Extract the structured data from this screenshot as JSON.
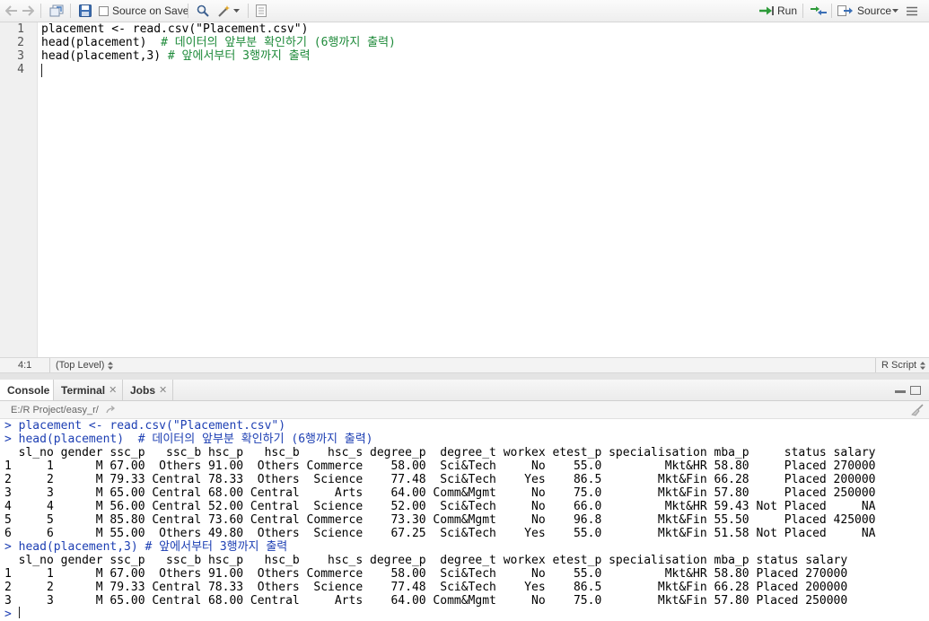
{
  "toolbar": {
    "source_on_save_label": "Source on Save",
    "run_label": "Run",
    "source_label": "Source"
  },
  "editor": {
    "line_numbers": [
      "1",
      "2",
      "3",
      "4"
    ],
    "lines": [
      {
        "code": "placement <- read.csv(\"Placement.csv\")",
        "comment": ""
      },
      {
        "code": "head(placement)  ",
        "comment": "# 데이터의 앞부분 확인하기 (6행까지 출력)"
      },
      {
        "code": "head(placement,3) ",
        "comment": "# 앞에서부터 3행까지 출력"
      },
      {
        "code": "",
        "comment": ""
      }
    ]
  },
  "statusbar": {
    "position": "4:1",
    "scope": "(Top Level)",
    "file_type": "R Script"
  },
  "console_tabs": [
    {
      "label": "Console",
      "closable": false
    },
    {
      "label": "Terminal",
      "closable": true
    },
    {
      "label": "Jobs",
      "closable": true
    }
  ],
  "console_path": "E:/R Project/easy_r/",
  "console_lines": [
    {
      "type": "cmd",
      "text": "> placement <- read.csv(\"Placement.csv\")"
    },
    {
      "type": "cmd",
      "text": "> head(placement)  # 데이터의 앞부분 확인하기 (6행까지 출력)"
    },
    {
      "type": "out",
      "text": "  sl_no gender ssc_p   ssc_b hsc_p   hsc_b    hsc_s degree_p  degree_t workex etest_p specialisation mba_p     status salary"
    },
    {
      "type": "out",
      "text": "1     1      M 67.00  Others 91.00  Others Commerce    58.00  Sci&Tech     No    55.0         Mkt&HR 58.80     Placed 270000"
    },
    {
      "type": "out",
      "text": "2     2      M 79.33 Central 78.33  Others  Science    77.48  Sci&Tech    Yes    86.5        Mkt&Fin 66.28     Placed 200000"
    },
    {
      "type": "out",
      "text": "3     3      M 65.00 Central 68.00 Central     Arts    64.00 Comm&Mgmt     No    75.0        Mkt&Fin 57.80     Placed 250000"
    },
    {
      "type": "out",
      "text": "4     4      M 56.00 Central 52.00 Central  Science    52.00  Sci&Tech     No    66.0         Mkt&HR 59.43 Not Placed     NA"
    },
    {
      "type": "out",
      "text": "5     5      M 85.80 Central 73.60 Central Commerce    73.30 Comm&Mgmt     No    96.8        Mkt&Fin 55.50     Placed 425000"
    },
    {
      "type": "out",
      "text": "6     6      M 55.00  Others 49.80  Others  Science    67.25  Sci&Tech    Yes    55.0        Mkt&Fin 51.58 Not Placed     NA"
    },
    {
      "type": "cmd",
      "text": "> head(placement,3) # 앞에서부터 3행까지 출력"
    },
    {
      "type": "out",
      "text": "  sl_no gender ssc_p   ssc_b hsc_p   hsc_b    hsc_s degree_p  degree_t workex etest_p specialisation mba_p status salary"
    },
    {
      "type": "out",
      "text": "1     1      M 67.00  Others 91.00  Others Commerce    58.00  Sci&Tech     No    55.0         Mkt&HR 58.80 Placed 270000"
    },
    {
      "type": "out",
      "text": "2     2      M 79.33 Central 78.33  Others  Science    77.48  Sci&Tech    Yes    86.5        Mkt&Fin 66.28 Placed 200000"
    },
    {
      "type": "out",
      "text": "3     3      M 65.00 Central 68.00 Central     Arts    64.00 Comm&Mgmt     No    75.0        Mkt&Fin 57.80 Placed 250000"
    },
    {
      "type": "cmd",
      "text": ">"
    }
  ],
  "colors": {
    "comment": "#1e8a3a",
    "command": "#1d3fb3",
    "run_arrow": "#2e9b3a"
  }
}
